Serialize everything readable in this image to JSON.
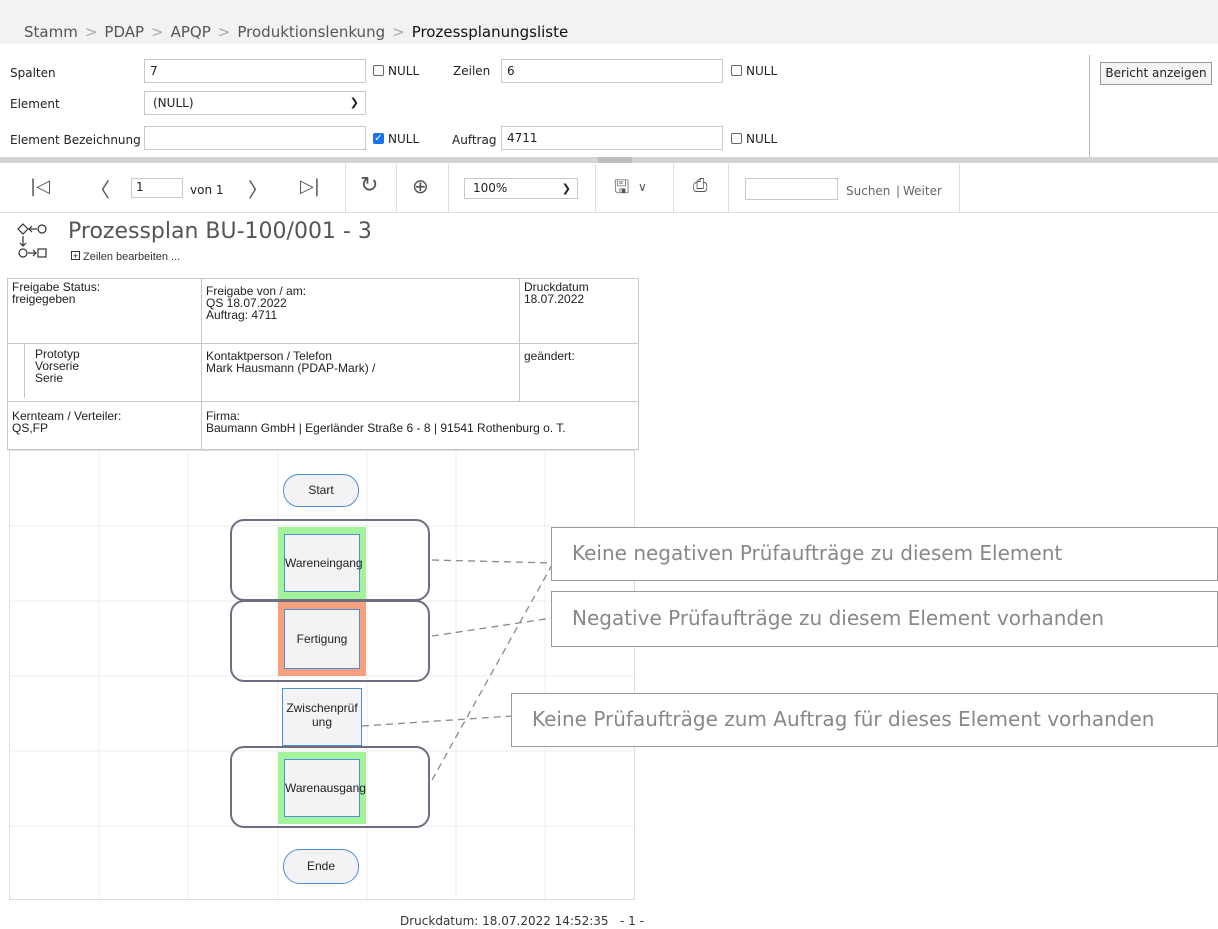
{
  "breadcrumb": {
    "items": [
      "Stamm",
      "PDAP",
      "APQP",
      "Produktionslenkung"
    ],
    "current": "Prozessplanungsliste",
    "separator": ">"
  },
  "params": {
    "spalten_label": "Spalten",
    "spalten_value": "7",
    "zeilen_label": "Zeilen",
    "zeilen_value": "6",
    "element_label": "Element",
    "element_value": "(NULL)",
    "bezeichnung_label": "Element Bezeichnung",
    "bezeichnung_value": "",
    "auftrag_label": "Auftrag",
    "auftrag_value": "4711",
    "null_label": "NULL",
    "report_button": "Bericht anzeigen"
  },
  "toolbar": {
    "page_value": "1",
    "page_of": "von 1",
    "zoom": "100%",
    "search_placeholder": "",
    "search_label": "Suchen",
    "next_label": "Weiter"
  },
  "report": {
    "title": "Prozessplan BU-100/001 - 3",
    "edit_rows_link": "Zeilen bearbeiten ...",
    "info": {
      "freigabe_status_label": "Freigabe Status:",
      "freigabe_status_value": "freigegeben",
      "freigabe_von_label": "Freigabe von / am:",
      "freigabe_von_value": "QS 18.07.2022",
      "auftrag_line": "Auftrag: 4711",
      "druckdatum_label": "Druckdatum",
      "druckdatum_value": "18.07.2022",
      "phase_1": "Prototyp",
      "phase_2": "Vorserie",
      "phase_3": "Serie",
      "kontakt_label": "Kontaktperson / Telefon",
      "kontakt_value": "Mark Hausmann (PDAP-Mark) /",
      "geaendert_label": "geändert:",
      "kernteam_label": "Kernteam / Verteiler:",
      "kernteam_value": "QS,FP",
      "firma_label": "Firma:",
      "firma_value": "Baumann GmbH | Egerländer Straße 6 - 8 | 91541 Rothenburg o. T."
    },
    "flow": {
      "start": "Start",
      "wareneingang": "Wareneingang",
      "fertigung": "Fertigung",
      "zwischenpruefung": "Zwischenprüfung",
      "warenausgang": "Warenausgang",
      "ende": "Ende"
    },
    "status_colors": {
      "no_negative": "#a5f29c",
      "negative": "#f7a07e"
    },
    "footer": "Druckdatum: 18.07.2022 14:52:35   - 1 -"
  },
  "callouts": {
    "c1": "Keine negativen Prüfaufträge zu diesem Element",
    "c2": "Negative Prüfaufträge zu diesem Element vorhanden",
    "c3": "Keine Prüfaufträge zum Auftrag für dieses Element vorhanden"
  }
}
